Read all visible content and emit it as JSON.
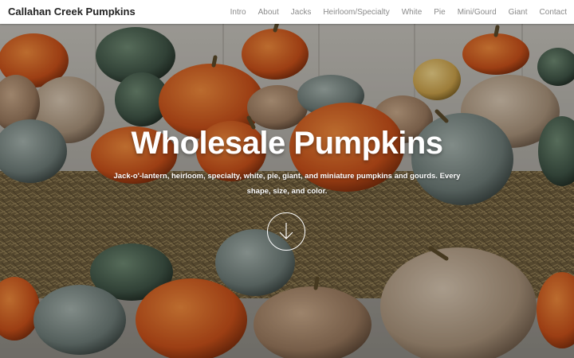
{
  "nav": {
    "brand": "Callahan Creek Pumpkins",
    "links": [
      "Intro",
      "About",
      "Jacks",
      "Heirloom/Specialty",
      "White",
      "Pie",
      "Mini/Gourd",
      "Giant",
      "Contact"
    ]
  },
  "hero": {
    "title": "Wholesale Pumpkins",
    "subtitle": "Jack-o'-lantern, heirloom, specialty, white, pie, giant, and miniature pumpkins and gourds. Every shape, size, and color.",
    "scroll_icon": "arrow-down-circle-icon"
  },
  "colors": {
    "nav_bg": "#ffffff",
    "brand_text": "#222222",
    "nav_link": "#8a8a8a",
    "hero_text": "#ffffff"
  }
}
